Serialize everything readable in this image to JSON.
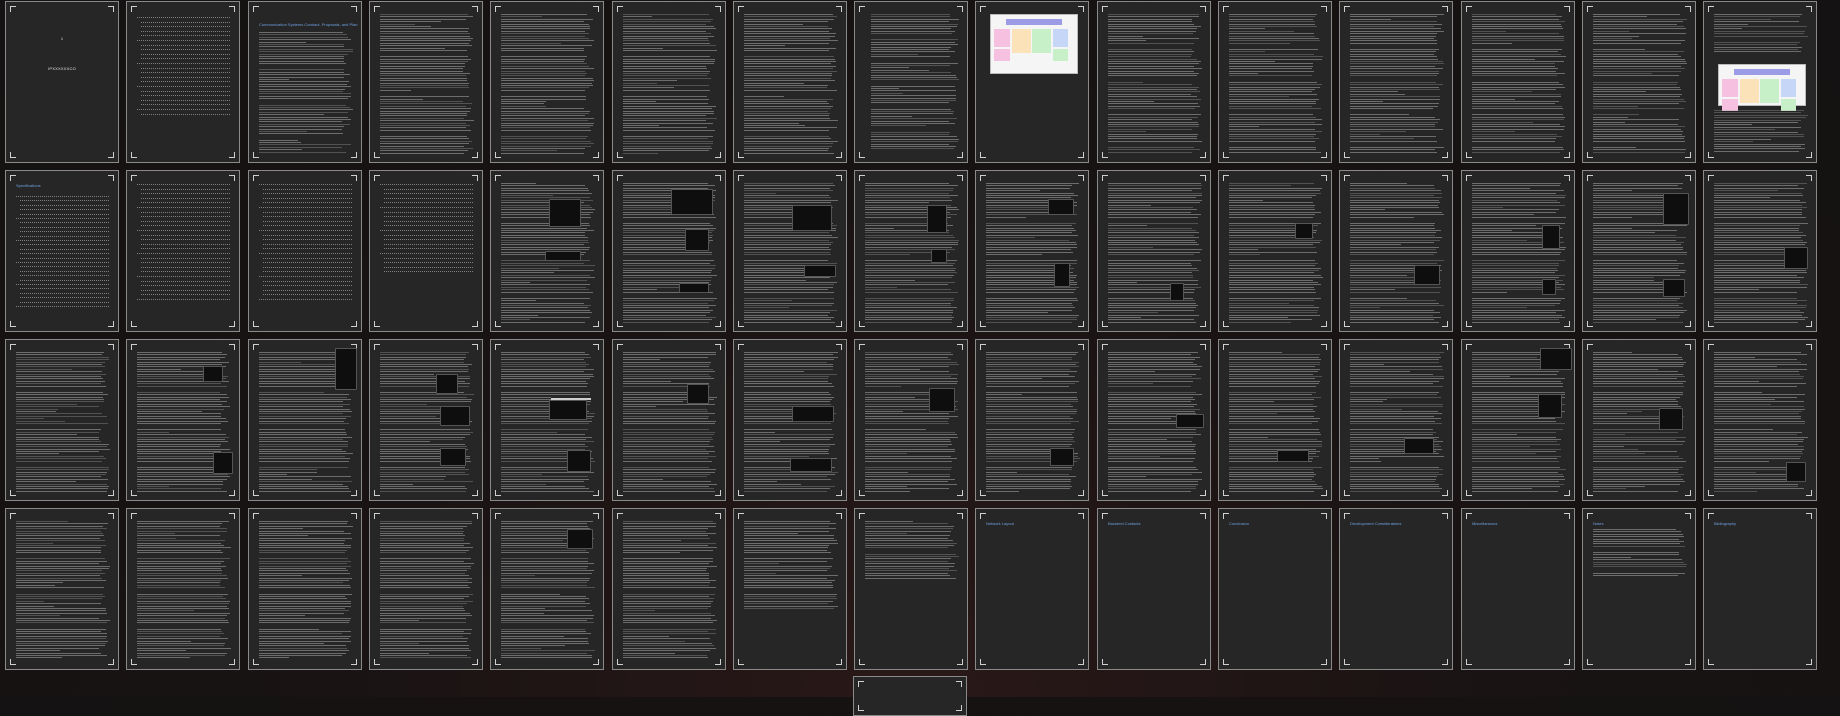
{
  "document": {
    "cover_number": "1",
    "cover_title": "IPXXXXXXCO"
  },
  "section_titles": {
    "p3": "Communication Systems Contract, Proposals, and Plan",
    "p17": "Specifications",
    "p57": "Network Layout",
    "p58": "Backend Contacts",
    "p59": "Conclusion",
    "p60": "Development Considerations",
    "p61": "Miscellaneous",
    "p62": "Notes",
    "p63": "Bibliography"
  },
  "palette": {
    "background": "#191313",
    "page": "#262626",
    "page_border": "#8a8a8a",
    "heading": "#6fa0e0",
    "text": "#a7a7a7"
  }
}
